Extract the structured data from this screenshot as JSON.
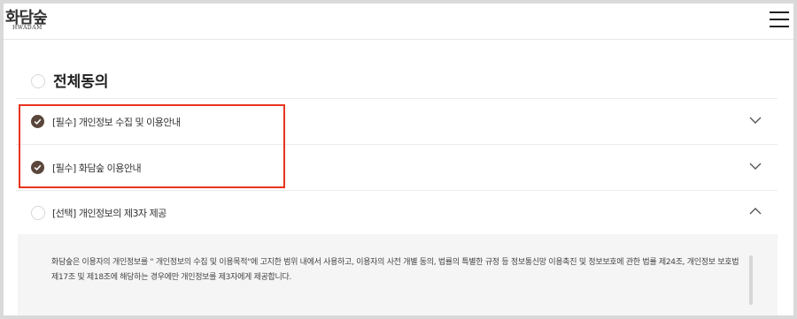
{
  "header": {
    "logo_main": "화담숲",
    "logo_sub": "HWADAM",
    "menu_icon": "hamburger-menu-icon"
  },
  "consent": {
    "all_agree_label": "전체동의",
    "items": [
      {
        "label": "[필수] 개인정보 수집 및 이용안내",
        "checked": true,
        "expanded": false
      },
      {
        "label": "[필수] 화담숲 이용안내",
        "checked": true,
        "expanded": false
      },
      {
        "label": "[선택] 개인정보의 제3자 제공",
        "checked": false,
        "expanded": true
      }
    ],
    "detail_text": "화담숲은 이용자의 개인정보를 \" 개인정보의 수집 및 이용목적\"에 고지한 범위 내에서 사용하고, 이용자의 사전 개별 동의, 법률의 특별한 규정 등 정보통신망 이용촉진 및 정보보호에 관한 법률 제24조, 개인정보 보호법 제17조 및 제18조에 해당하는 경우에만 개인정보를 제3자에게 제공합니다."
  },
  "colors": {
    "check_fill": "#5a463a",
    "highlight_border": "#e8331f",
    "detail_bg": "#f5f5f5"
  }
}
